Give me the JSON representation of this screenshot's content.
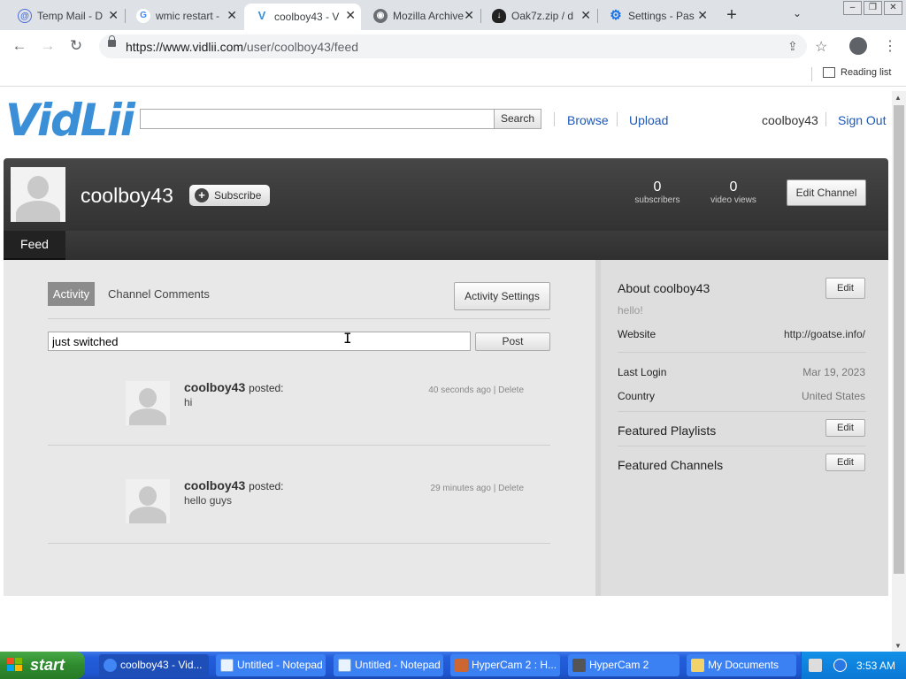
{
  "browser": {
    "tabs": [
      {
        "title": "Temp Mail - D",
        "icon_name": "temp-mail-icon"
      },
      {
        "title": "wmic restart -",
        "icon_name": "google-icon"
      },
      {
        "title": "coolboy43 - V",
        "icon_name": "vidlii-icon"
      },
      {
        "title": "Mozilla Archive",
        "icon_name": "globe-icon"
      },
      {
        "title": "Oak7z.zip / d",
        "icon_name": "cloud-download-icon"
      },
      {
        "title": "Settings - Pas",
        "icon_name": "settings-gear-icon"
      }
    ],
    "url_host": "https://www.vidlii.com",
    "url_path": "/user/coolboy43/feed",
    "reading_list": "Reading list"
  },
  "site": {
    "logo": "VidLii",
    "search_button": "Search",
    "nav": {
      "browse": "Browse",
      "upload": "Upload",
      "user": "coolboy43",
      "sign_out": "Sign Out"
    }
  },
  "channel": {
    "name": "coolboy43",
    "subscribe": "Subscribe",
    "subscribers_count": "0",
    "subscribers_label": "subscribers",
    "views_count": "0",
    "views_label": "video views",
    "edit_channel": "Edit Channel",
    "tab_feed": "Feed"
  },
  "feed": {
    "tab_activity": "Activity",
    "tab_comments": "Channel Comments",
    "activity_settings": "Activity Settings",
    "input_value": "just switched",
    "post_button": "Post",
    "posts": [
      {
        "user": "coolboy43",
        "verb": "posted:",
        "text": "hi",
        "time": "40 seconds ago",
        "delete": "Delete"
      },
      {
        "user": "coolboy43",
        "verb": "posted:",
        "text": "hello guys",
        "time": "29 minutes ago",
        "delete": "Delete"
      }
    ]
  },
  "about": {
    "title": "About coolboy43",
    "edit": "Edit",
    "bio": "hello!",
    "website_label": "Website",
    "website_value": "http://goatse.info/",
    "last_login_label": "Last Login",
    "last_login_value": "Mar 19, 2023",
    "country_label": "Country",
    "country_value": "United States",
    "featured_playlists": "Featured Playlists",
    "featured_channels": "Featured Channels"
  },
  "taskbar": {
    "start": "start",
    "tasks": [
      {
        "label": "coolboy43 - Vid...",
        "icon_name": "chrome-icon"
      },
      {
        "label": "Untitled - Notepad",
        "icon_name": "notepad-icon"
      },
      {
        "label": "Untitled - Notepad",
        "icon_name": "notepad-icon"
      },
      {
        "label": "HyperCam 2 : H...",
        "icon_name": "hypercam-icon"
      },
      {
        "label": "HyperCam 2",
        "icon_name": "hypercam-icon"
      },
      {
        "label": "My Documents",
        "icon_name": "folder-icon"
      }
    ],
    "clock": "3:53 AM"
  },
  "colors": {
    "link": "#1d57b7",
    "logo": "#3b8fd6",
    "taskbar": "#245edb",
    "start_green": "#2f8a2e"
  }
}
